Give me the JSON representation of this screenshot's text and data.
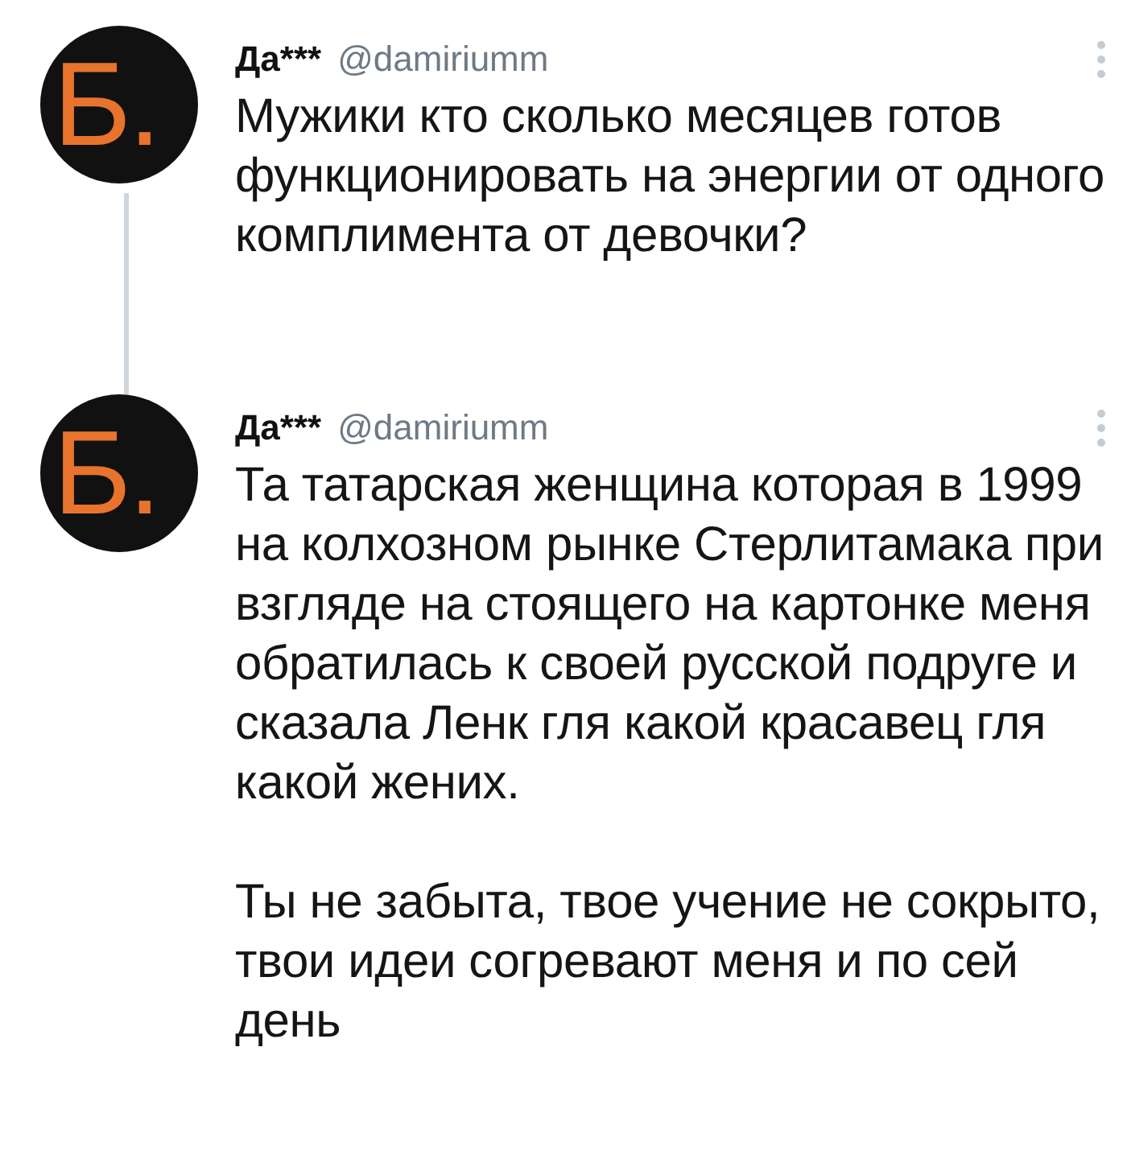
{
  "tweets": [
    {
      "avatar_text": "Б.",
      "name": "Да***",
      "handle": "@damiriumm",
      "paragraphs": [
        "Мужики кто сколько месяцев готов функционировать на энергии от одного комплимента от девочки?"
      ],
      "thread_line": true
    },
    {
      "avatar_text": "Б.",
      "name": "Да***",
      "handle": "@damiriumm",
      "paragraphs": [
        "Та татарская женщина которая в 1999 на колхозном рынке Стерлитамака при взгляде на стоящего на картонке меня обратилась к своей русской подруге и сказала Ленк гля какой красавец гля какой жених.",
        "Ты не забыта, твое учение не сокрыто, твои идеи согревают меня и по сей день"
      ],
      "thread_line": false
    }
  ]
}
